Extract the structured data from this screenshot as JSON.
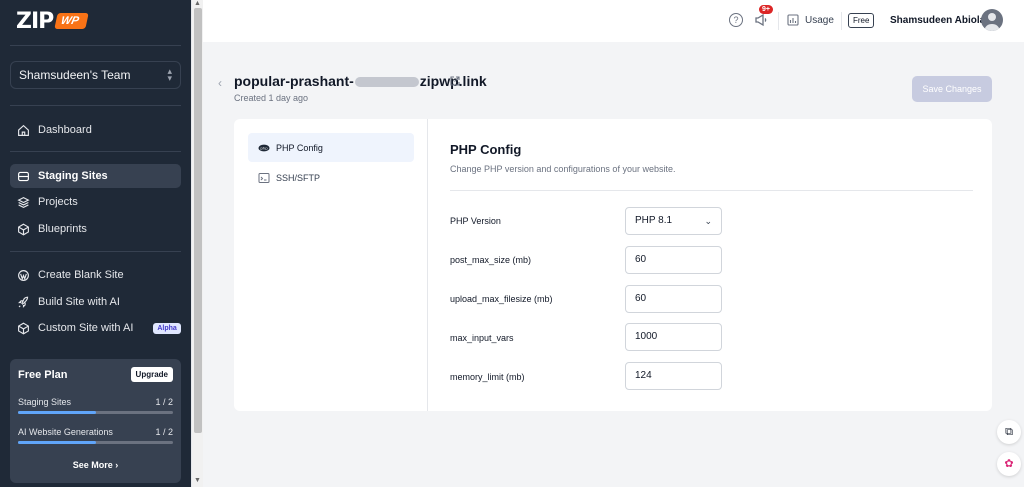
{
  "brand": {
    "logo_text": "ZIP",
    "logo_badge": "WP"
  },
  "team": {
    "name": "Shamsudeen's Team"
  },
  "sidebar": {
    "items": [
      {
        "label": "Dashboard",
        "icon": "home-icon"
      },
      {
        "label": "Staging Sites",
        "icon": "layers-icon",
        "active": true
      },
      {
        "label": "Projects",
        "icon": "stack-icon"
      },
      {
        "label": "Blueprints",
        "icon": "cube-icon"
      },
      {
        "label": "Create Blank Site",
        "icon": "wordpress-icon"
      },
      {
        "label": "Build Site with AI",
        "icon": "rocket-icon"
      },
      {
        "label": "Custom Site with AI",
        "icon": "sparkle-cube-icon",
        "badge": "Alpha"
      }
    ]
  },
  "plan": {
    "title": "Free Plan",
    "upgrade_label": "Upgrade",
    "staging_label": "Staging Sites",
    "staging_count": "1 / 2",
    "staging_fraction": 0.5,
    "ai_label": "AI Website Generations",
    "ai_count": "1 / 2",
    "ai_fraction": 0.5,
    "see_more": "See More"
  },
  "topbar": {
    "notification_badge": "9+",
    "usage_label": "Usage",
    "plan_badge": "Free",
    "user_name": "Shamsudeen Abiola"
  },
  "site": {
    "name_prefix": "popular-prashant-",
    "name_suffix": "zipwp.link",
    "created": "Created 1 day ago",
    "save_label": "Save Changes"
  },
  "settings_menu": [
    {
      "label": "PHP Config",
      "icon": "php-icon",
      "active": true
    },
    {
      "label": "SSH/SFTP",
      "icon": "terminal-icon"
    }
  ],
  "php_config": {
    "title": "PHP Config",
    "subtitle": "Change PHP version and configurations of your website.",
    "fields": [
      {
        "label": "PHP Version",
        "value": "PHP 8.1",
        "type": "select"
      },
      {
        "label": "post_max_size (mb)",
        "value": "60"
      },
      {
        "label": "upload_max_filesize (mb)",
        "value": "60"
      },
      {
        "label": "max_input_vars",
        "value": "1000"
      },
      {
        "label": "memory_limit (mb)",
        "value": "124"
      }
    ]
  },
  "colors": {
    "sidebar_bg": "#1f2937",
    "accent": "#f97316",
    "badge_red": "#dc2626",
    "save_disabled": "#c7cbe0"
  }
}
